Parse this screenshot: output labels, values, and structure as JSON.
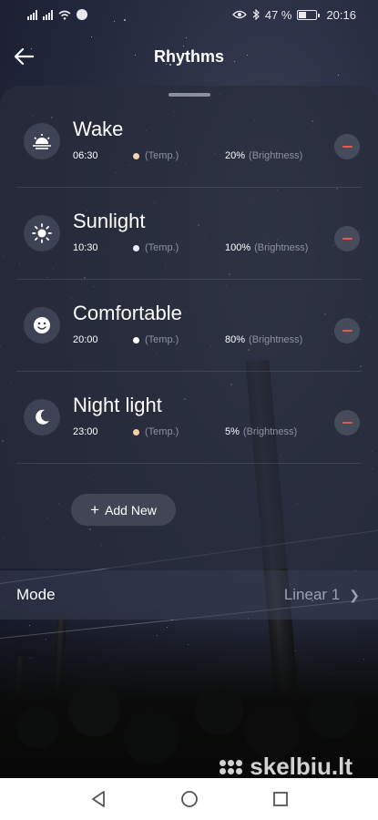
{
  "status_bar": {
    "battery_percent": "47 %",
    "time": "20:16"
  },
  "header": {
    "title": "Rhythms",
    "back_icon": "arrow-left-icon"
  },
  "rhythms": [
    {
      "name": "Wake",
      "time": "06:30",
      "dot_color": "#f3d3b1",
      "temp_label": "(Temp.)",
      "brightness": "20%",
      "brightness_label": "(Brightness)",
      "icon": "sunrise-icon"
    },
    {
      "name": "Sunlight",
      "time": "10:30",
      "dot_color": "#e9ecf7",
      "temp_label": "(Temp.)",
      "brightness": "100%",
      "brightness_label": "(Brightness)",
      "icon": "sun-icon"
    },
    {
      "name": "Comfortable",
      "time": "20:00",
      "dot_color": "#ffffff",
      "temp_label": "(Temp.)",
      "brightness": "80%",
      "brightness_label": "(Brightness)",
      "icon": "smiley-icon"
    },
    {
      "name": "Night light",
      "time": "23:00",
      "dot_color": "#f6cfa6",
      "temp_label": "(Temp.)",
      "brightness": "5%",
      "brightness_label": "(Brightness)",
      "icon": "moon-icon"
    }
  ],
  "add_button": {
    "label": "Add New"
  },
  "mode": {
    "label": "Mode",
    "value": "Linear 1"
  },
  "watermark": {
    "text": "skelbiu.lt"
  },
  "colors": {
    "remove_accent": "#e25a4e",
    "panel": "#282c3c"
  }
}
